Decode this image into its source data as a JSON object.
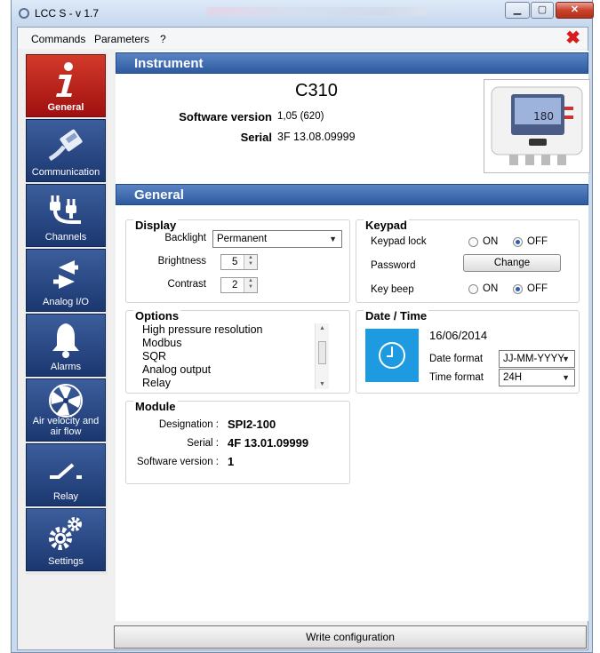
{
  "window": {
    "title": "LCC S - v 1.7"
  },
  "menu": {
    "items": [
      "Commands",
      "Parameters",
      "?"
    ]
  },
  "sidebar": {
    "items": [
      {
        "label": "General",
        "icon": "info-icon",
        "active": true
      },
      {
        "label": "Communication",
        "icon": "network-cable-icon",
        "active": false
      },
      {
        "label": "Channels",
        "icon": "plug-icon",
        "active": false
      },
      {
        "label": "Analog I/O",
        "icon": "arrows-io-icon",
        "active": false
      },
      {
        "label": "Alarms",
        "icon": "bell-icon",
        "active": false
      },
      {
        "label": "Air velocity and air flow",
        "icon": "fan-icon",
        "active": false
      },
      {
        "label": "Relay",
        "icon": "switch-icon",
        "active": false
      },
      {
        "label": "Settings",
        "icon": "gears-icon",
        "active": false
      }
    ]
  },
  "instrument": {
    "header": "Instrument",
    "model": "C310",
    "software_label": "Software version",
    "software_value": "1,05 (620)",
    "serial_label": "Serial",
    "serial_value": "3F 13.08.09999",
    "device_screen_value": "180"
  },
  "general": {
    "header": "General",
    "display": {
      "title": "Display",
      "backlight_label": "Backlight",
      "backlight_value": "Permanent",
      "brightness_label": "Brightness",
      "brightness_value": "5",
      "contrast_label": "Contrast",
      "contrast_value": "2"
    },
    "keypad": {
      "title": "Keypad",
      "lock_label": "Keypad lock",
      "password_label": "Password",
      "change_label": "Change",
      "beep_label": "Key beep",
      "on_label": "ON",
      "off_label": "OFF",
      "lock_state": "OFF",
      "beep_state": "OFF"
    },
    "options": {
      "title": "Options",
      "items": [
        "High pressure resolution",
        "Modbus",
        "SQR",
        "Analog output",
        "Relay"
      ]
    },
    "datetime": {
      "title": "Date / Time",
      "date": "16/06/2014",
      "date_format_label": "Date format",
      "date_format_value": "JJ-MM-YYYY",
      "time_format_label": "Time format",
      "time_format_value": "24H"
    },
    "module": {
      "title": "Module",
      "designation_label": "Designation :",
      "designation_value": "SPI2-100",
      "serial_label": "Serial :",
      "serial_value": "4F 13.01.09999",
      "software_label": "Software version :",
      "software_value": "1"
    }
  },
  "footer": {
    "write_label": "Write configuration"
  },
  "colors": {
    "section": "#2e5aa0",
    "nav": "#1b3770",
    "nav_active": "#a01010",
    "clock_tile": "#1e9be0"
  }
}
